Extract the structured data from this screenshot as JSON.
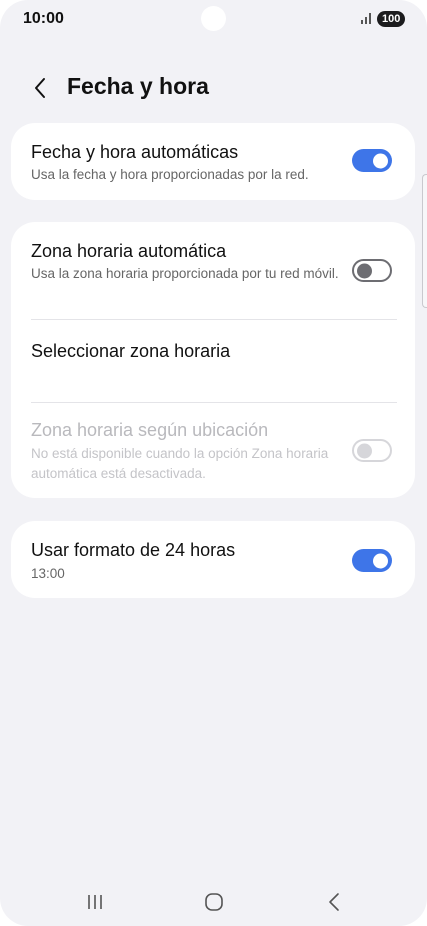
{
  "status_bar": {
    "time": "10:00",
    "battery": "100",
    "signal_icon": "signal-bars-icon"
  },
  "header": {
    "title": "Fecha y hora",
    "back_icon": "chevron-left-icon"
  },
  "settings": {
    "auto_datetime": {
      "title": "Fecha y hora automáticas",
      "subtitle": "Usa la fecha y hora proporcionadas por la red.",
      "enabled": true
    },
    "auto_timezone": {
      "title": "Zona horaria automática",
      "subtitle": "Usa la zona horaria proporcionada por tu red móvil.",
      "enabled": false
    },
    "select_timezone": {
      "title": "Seleccionar zona horaria"
    },
    "location_timezone": {
      "title": "Zona horaria según ubicación",
      "subtitle": "No está disponible cuando la opción Zona horaria automática está desactivada.",
      "enabled": false,
      "disabled": true
    },
    "format_24h": {
      "title": "Usar formato de 24 horas",
      "subtitle": "13:00",
      "enabled": true
    }
  },
  "colors": {
    "accent": "#3e75e8",
    "background": "#f2f2f6",
    "card": "#ffffff"
  },
  "nav_bar": {
    "recents_icon": "recent-apps-icon",
    "home_icon": "home-icon",
    "back_icon": "back-icon"
  }
}
